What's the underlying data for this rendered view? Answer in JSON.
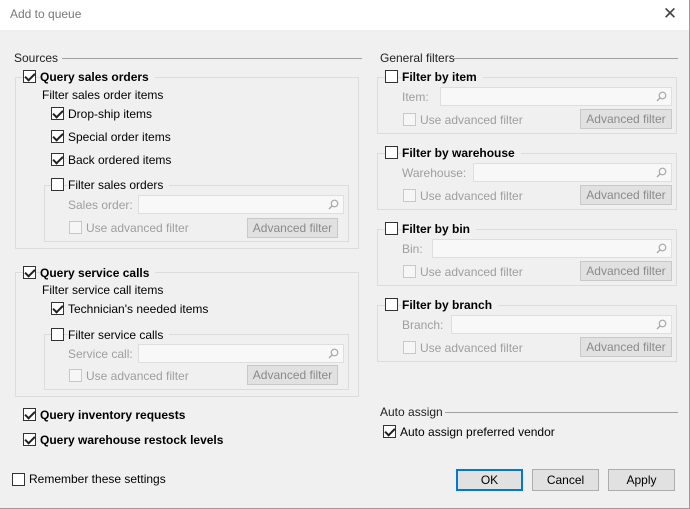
{
  "window": {
    "title": "Add to queue"
  },
  "sources": {
    "heading": "Sources",
    "sales_orders": {
      "label": "Query sales orders",
      "checked": true,
      "subheading": "Filter sales order items",
      "items": [
        {
          "label": "Drop-ship items",
          "checked": true
        },
        {
          "label": "Special order items",
          "checked": true
        },
        {
          "label": "Back ordered items",
          "checked": true
        }
      ],
      "filter": {
        "label": "Filter sales orders",
        "field_label": "Sales order:",
        "advanced_label": "Use advanced filter",
        "button": "Advanced filter"
      }
    },
    "service_calls": {
      "label": "Query service calls",
      "checked": true,
      "subheading": "Filter service call items",
      "items": [
        {
          "label": "Technician's needed items",
          "checked": true
        }
      ],
      "filter": {
        "label": "Filter service calls",
        "field_label": "Service call:",
        "advanced_label": "Use advanced filter",
        "button": "Advanced filter"
      }
    },
    "inventory_requests": {
      "label": "Query inventory requests",
      "checked": true
    },
    "restock_levels": {
      "label": "Query warehouse restock levels",
      "checked": true
    }
  },
  "general_filters": {
    "heading": "General filters",
    "filters": [
      {
        "label": "Filter by item",
        "field_label": "Item:",
        "advanced_label": "Use advanced filter",
        "button": "Advanced filter"
      },
      {
        "label": "Filter by warehouse",
        "field_label": "Warehouse:",
        "advanced_label": "Use advanced filter",
        "button": "Advanced filter"
      },
      {
        "label": "Filter by bin",
        "field_label": "Bin:",
        "advanced_label": "Use advanced filter",
        "button": "Advanced filter"
      },
      {
        "label": "Filter by branch",
        "field_label": "Branch:",
        "advanced_label": "Use advanced filter",
        "button": "Advanced filter"
      }
    ]
  },
  "auto_assign": {
    "heading": "Auto assign",
    "label": "Auto assign preferred vendor",
    "checked": true
  },
  "footer": {
    "remember_label": "Remember these settings",
    "ok": "OK",
    "cancel": "Cancel",
    "apply": "Apply"
  }
}
